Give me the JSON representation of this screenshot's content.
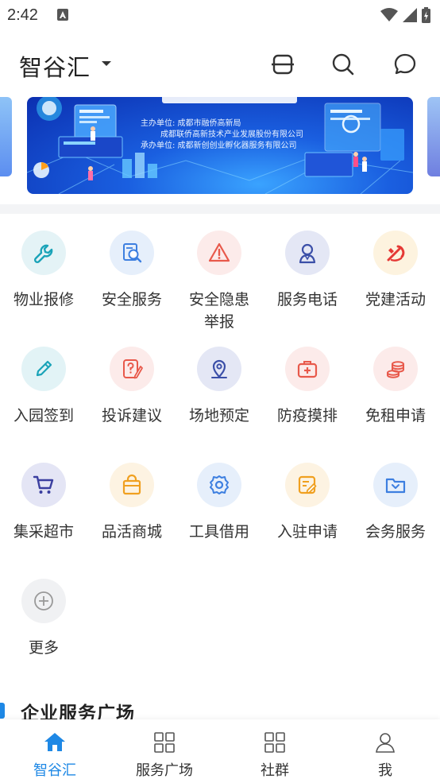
{
  "status_bar": {
    "time": "2:42"
  },
  "header": {
    "title": "智谷汇"
  },
  "banner": {
    "host_line": "主办单位: 成都市融侨高新局",
    "co_host_line": "成都联侨高新技术产业发展股份有限公司",
    "organizer_line": "承办单位: 成都新创创业孵化器服务有限公司"
  },
  "services": [
    {
      "label": "物业报修",
      "icon": "wrench-icon",
      "bg": "#e4f3f6",
      "color": "#1aa3b8"
    },
    {
      "label": "安全服务",
      "icon": "search-document-icon",
      "bg": "#e6effb",
      "color": "#3d7fe0"
    },
    {
      "label": "安全隐患\n举报",
      "icon": "warning-icon",
      "bg": "#fcebea",
      "color": "#e8594b"
    },
    {
      "label": "服务电话",
      "icon": "customer-service-icon",
      "bg": "#e4e7f5",
      "color": "#3b4fa8"
    },
    {
      "label": "党建活动",
      "icon": "party-emblem-icon",
      "bg": "#fdf3df",
      "color": "#e53935"
    },
    {
      "label": "入园签到",
      "icon": "pencil-icon",
      "bg": "#e2f3f6",
      "color": "#1aa3b8"
    },
    {
      "label": "投诉建议",
      "icon": "feedback-icon",
      "bg": "#fcebea",
      "color": "#e8594b"
    },
    {
      "label": "场地预定",
      "icon": "location-icon",
      "bg": "#e4e7f5",
      "color": "#3b4fa8"
    },
    {
      "label": "防疫摸排",
      "icon": "medical-kit-icon",
      "bg": "#fcebea",
      "color": "#e8594b"
    },
    {
      "label": "免租申请",
      "icon": "coins-icon",
      "bg": "#fcebea",
      "color": "#e8594b"
    },
    {
      "label": "集采超市",
      "icon": "cart-icon",
      "bg": "#e4e5f5",
      "color": "#3b3fa0"
    },
    {
      "label": "品活商城",
      "icon": "shopping-bag-icon",
      "bg": "#fdf3e2",
      "color": "#f0a020"
    },
    {
      "label": "工具借用",
      "icon": "gear-icon",
      "bg": "#e6effb",
      "color": "#3d7fe0"
    },
    {
      "label": "入驻申请",
      "icon": "form-edit-icon",
      "bg": "#fdf3e2",
      "color": "#f0a020"
    },
    {
      "label": "会务服务",
      "icon": "folder-icon",
      "bg": "#e6effb",
      "color": "#3d7fe0"
    },
    {
      "label": "更多",
      "icon": "plus-circle-icon",
      "bg": "#f0f1f3",
      "color": "#999999"
    }
  ],
  "section": {
    "title": "企业服务广场"
  },
  "bottom_nav": [
    {
      "label": "智谷汇",
      "icon": "home-icon",
      "active": true
    },
    {
      "label": "服务广场",
      "icon": "grid-icon",
      "active": false
    },
    {
      "label": "社群",
      "icon": "community-grid-icon",
      "active": false
    },
    {
      "label": "我",
      "icon": "user-icon",
      "active": false
    }
  ],
  "colors": {
    "accent": "#1e88e5"
  }
}
